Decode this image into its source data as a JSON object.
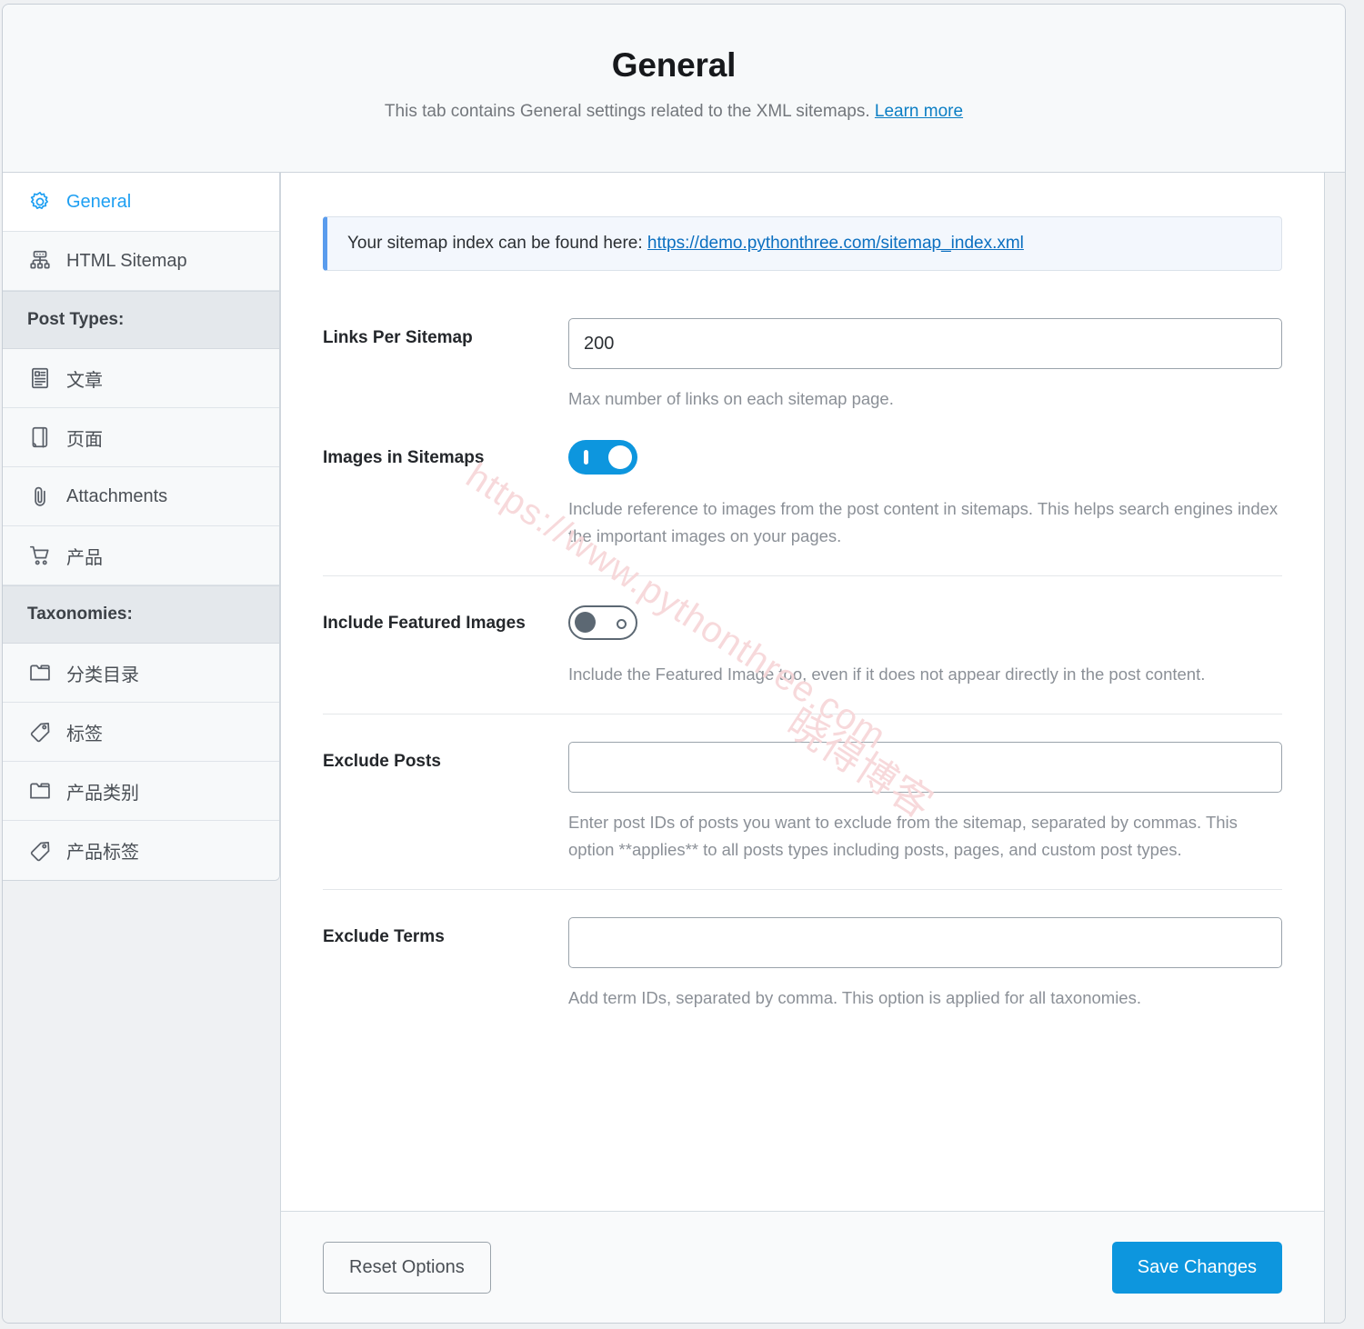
{
  "header": {
    "title": "General",
    "subtitle": "This tab contains General settings related to the XML sitemaps.",
    "learn_more": "Learn more"
  },
  "sidebar": {
    "items": [
      {
        "label": "General",
        "icon": "gear-icon",
        "type": "item",
        "active": true
      },
      {
        "label": "HTML Sitemap",
        "icon": "sitemap-icon",
        "type": "item",
        "active": false
      },
      {
        "label": "Post Types:",
        "icon": "",
        "type": "group",
        "active": false
      },
      {
        "label": "文章",
        "icon": "article-icon",
        "type": "item",
        "active": false
      },
      {
        "label": "页面",
        "icon": "page-icon",
        "type": "item",
        "active": false
      },
      {
        "label": "Attachments",
        "icon": "paperclip-icon",
        "type": "item",
        "active": false
      },
      {
        "label": "产品",
        "icon": "cart-icon",
        "type": "item",
        "active": false
      },
      {
        "label": "Taxonomies:",
        "icon": "",
        "type": "group",
        "active": false
      },
      {
        "label": "分类目录",
        "icon": "folder-icon",
        "type": "item",
        "active": false
      },
      {
        "label": "标签",
        "icon": "tag-icon",
        "type": "item",
        "active": false
      },
      {
        "label": "产品类别",
        "icon": "folder-icon",
        "type": "item",
        "active": false
      },
      {
        "label": "产品标签",
        "icon": "tag-icon",
        "type": "item",
        "active": false
      }
    ]
  },
  "notice": {
    "text": "Your sitemap index can be found here:",
    "link_text": "https://demo.pythonthree.com/sitemap_index.xml"
  },
  "fields": {
    "links_per_sitemap": {
      "label": "Links Per Sitemap",
      "value": "200",
      "placeholder": "",
      "help": "Max number of links on each sitemap page."
    },
    "images_in_sitemaps": {
      "label": "Images in Sitemaps",
      "state": "on",
      "help": "Include reference to images from the post content in sitemaps. This helps search engines index the important images on your pages."
    },
    "include_featured_images": {
      "label": "Include Featured Images",
      "state": "off",
      "help": "Include the Featured Image too, even if it does not appear directly in the post content."
    },
    "exclude_posts": {
      "label": "Exclude Posts",
      "value": "",
      "placeholder": "",
      "help": "Enter post IDs of posts you want to exclude from the sitemap, separated by commas. This option **applies** to all posts types including posts, pages, and custom post types."
    },
    "exclude_terms": {
      "label": "Exclude Terms",
      "value": "",
      "placeholder": "",
      "help": "Add term IDs, separated by comma. This option is applied for all taxonomies."
    }
  },
  "footer": {
    "reset_label": "Reset Options",
    "save_label": "Save Changes"
  },
  "watermark": {
    "url": "https://www.pythonthree.com",
    "cn": "晓得博客"
  },
  "colors": {
    "accent": "#0d96de",
    "link": "#0b6fc0",
    "notice_bar": "#5a9ced",
    "toggle_off": "#5c6873"
  }
}
